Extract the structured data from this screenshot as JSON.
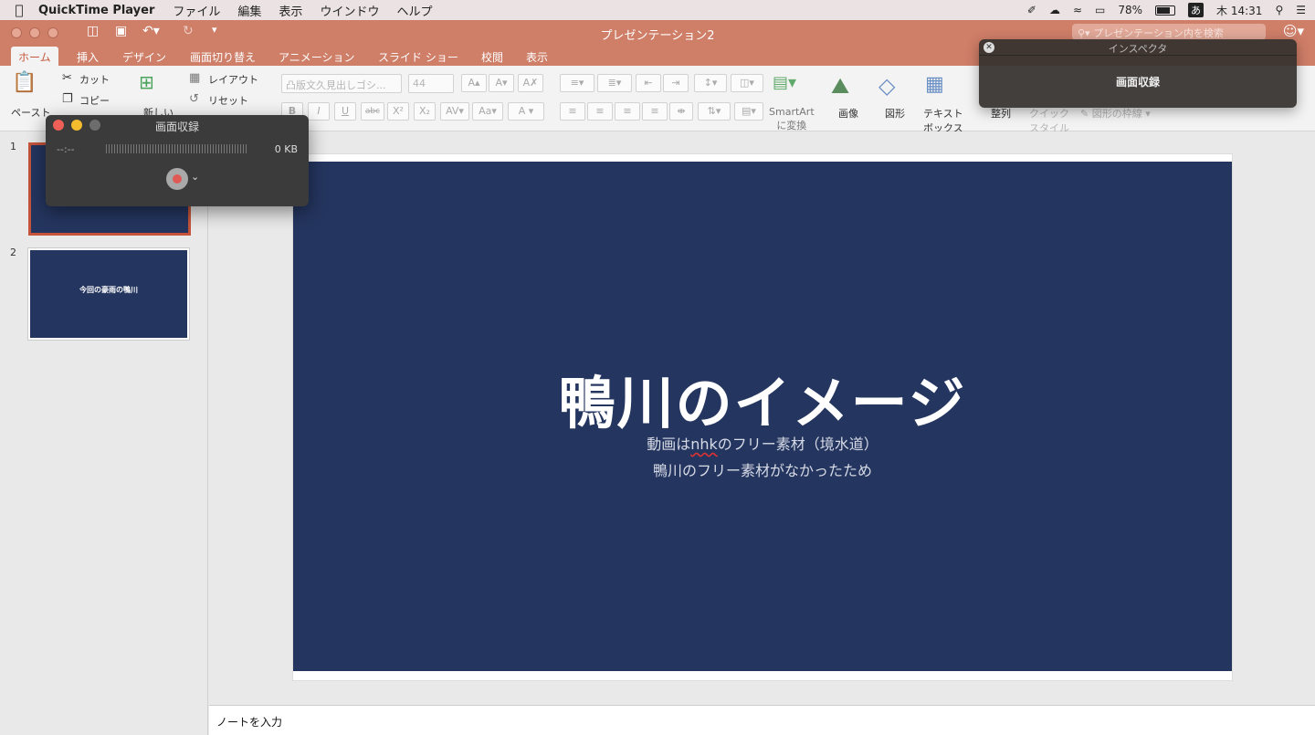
{
  "menubar": {
    "app_name": "QuickTime Player",
    "items": [
      "ファイル",
      "編集",
      "表示",
      "ウインドウ",
      "ヘルプ"
    ],
    "battery": "78%",
    "ime": "あ",
    "clock": "木 14:31"
  },
  "window": {
    "title": "プレゼンテーション2",
    "search_placeholder": "プレゼンテーション内を検索"
  },
  "tabs": [
    "ホーム",
    "挿入",
    "デザイン",
    "画面切り替え",
    "アニメーション",
    "スライド ショー",
    "校閲",
    "表示"
  ],
  "ribbon": {
    "paste": "ペースト",
    "cut": "カット",
    "copy": "コピー",
    "new_slide": "新しい",
    "layout": "レイアウト",
    "reset": "リセット",
    "font_name": "凸版文久見出しゴシ...",
    "font_size": "44",
    "smartart": "SmartArt",
    "smartart_sub": "に変換",
    "image": "画像",
    "shape": "図形",
    "textbox": "テキスト",
    "textbox_sub": "ボックス",
    "arrange": "整列",
    "quick_style": "クイック",
    "quick_style_sub": "スタイル",
    "shape_outline": "図形の枠線"
  },
  "thumbnails": [
    {
      "number": "1",
      "text": ""
    },
    {
      "number": "2",
      "text": "今回の豪雨の鴨川"
    }
  ],
  "slide": {
    "title": "鴨川のイメージ",
    "subtitle_prefix": "動画は",
    "subtitle_link": "nhk",
    "subtitle_suffix": "のフリー素材（境水道）",
    "subtitle_line2": "鴨川のフリー素材がなかったため"
  },
  "notes_placeholder": "ノートを入力",
  "recording_panel": {
    "title": "画面収録",
    "time": "--:--",
    "size": "0 KB"
  },
  "inspector": {
    "header": "インスペクタ",
    "body": "画面収録"
  },
  "colors": {
    "accent": "#cf7e68",
    "slide_bg": "#24355f",
    "record_red": "#e05a55"
  }
}
